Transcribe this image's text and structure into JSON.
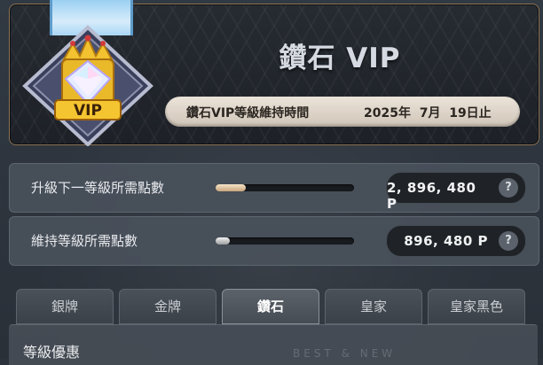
{
  "header": {
    "title": "鑽石 VIP",
    "badge_text": "VIP",
    "maintenance_label": "鑽石VIP等級維持時間",
    "maintenance_date": "2025年  7月  19日止"
  },
  "progress_rows": [
    {
      "label": "升級下一等級所需點數",
      "points": "2, 896, 480",
      "unit": "P",
      "help": "?",
      "progress_fraction": 0.22,
      "fill_color": "#d9b994"
    },
    {
      "label": "維持等級所需點數",
      "points": "896, 480",
      "unit": "P",
      "help": "?",
      "progress_fraction": 0.1,
      "fill_color": "#cfcfcf"
    }
  ],
  "tabs": [
    {
      "label": "銀牌",
      "active": false
    },
    {
      "label": "金牌",
      "active": false
    },
    {
      "label": "鑽石",
      "active": true
    },
    {
      "label": "皇家",
      "active": false
    },
    {
      "label": "皇家黑色",
      "active": false
    }
  ],
  "benefits": {
    "title": "等級優惠",
    "watermark": "BEST & NEW"
  },
  "colors": {
    "accent_border": "#8c7354",
    "gold": "#f2c230",
    "ribbon_blue": "#9bd0f2"
  }
}
